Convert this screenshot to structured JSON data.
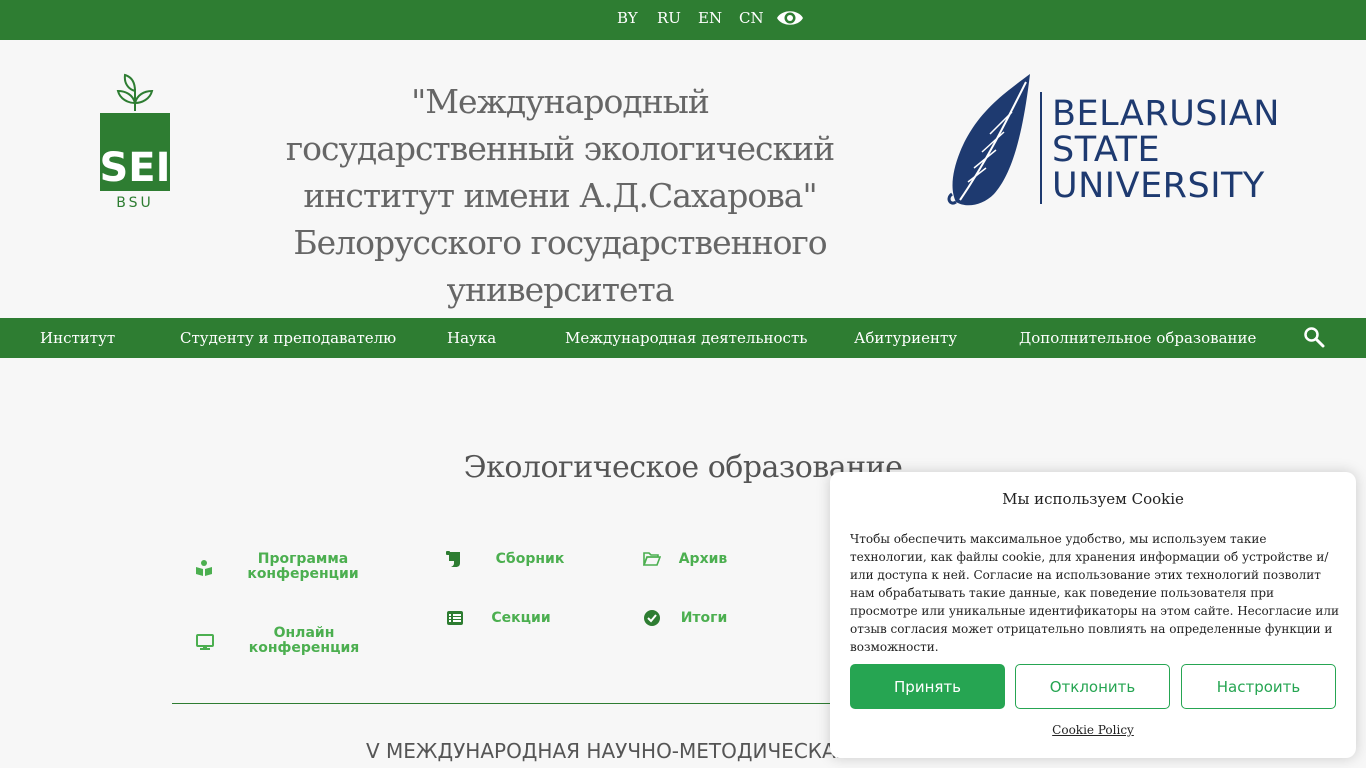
{
  "topbar": {
    "languages": [
      "BY",
      "RU",
      "EN",
      "CN"
    ],
    "accessibility_icon": "eye-icon"
  },
  "header": {
    "title": "\"Международный государственный экологический институт имени А.Д.Сахарова\" Белорусского государственного университета",
    "logo_left_text": "SEI",
    "logo_left_sub": "BSU",
    "logo_right_lines": [
      "BELARUSIAN",
      "STATE",
      "UNIVERSITY"
    ]
  },
  "nav": {
    "items": [
      "Институт",
      "Студенту и преподавателю",
      "Наука",
      "Международная деятельность",
      "Абитуриенту",
      "Дополнительное образование"
    ],
    "search_icon": "search-icon"
  },
  "main": {
    "section_title": "Экологическое образование",
    "links": [
      {
        "label": "Программа конференции",
        "icon": "book-icon"
      },
      {
        "label": "Сборник",
        "icon": "scroll-icon"
      },
      {
        "label": "Архив",
        "icon": "folder-open-icon"
      },
      {
        "label": "Онлайн конференция",
        "icon": "desktop-icon"
      },
      {
        "label": "Секции",
        "icon": "list-icon"
      },
      {
        "label": "Итоги",
        "icon": "check-circle-icon"
      }
    ],
    "bottom_title": "V МЕЖДУНАРОДНАЯ НАУЧНО-МЕТОДИЧЕСКАЯ"
  },
  "cookie": {
    "title": "Мы используем Cookie",
    "text": "Чтобы обеспечить максимальное удобство, мы используем такие технологии, как файлы cookie, для хранения информации об устройстве и/или доступа к ней. Согласие на использование этих технологий позволит нам обрабатывать такие данные, как поведение пользователя при просмотре или уникальные идентификаторы на этом сайте. Несогласие или отзыв согласия может отрицательно повлиять на определенные функции и возможности.",
    "accept": "Принять",
    "decline": "Отклонить",
    "customize": "Настроить",
    "policy": "Cookie Policy"
  },
  "colors": {
    "brand_green": "#2e7d32",
    "link_green": "#4caf50",
    "button_green": "#26a552",
    "bsu_blue": "#1e3a70"
  }
}
